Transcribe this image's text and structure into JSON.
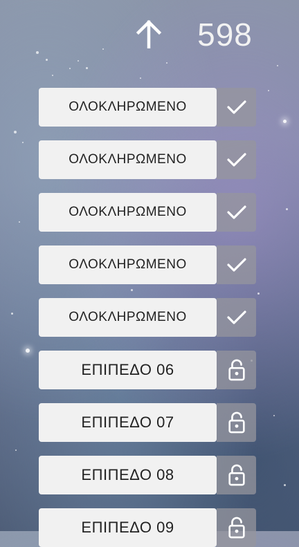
{
  "header": {
    "up_icon": "arrow-up-icon",
    "score": "598"
  },
  "levels": [
    {
      "label": "ΟΛΟΚΛΗΡΩΜΕΝΟ",
      "status": "completed",
      "icon": "check-icon"
    },
    {
      "label": "ΟΛΟΚΛΗΡΩΜΕΝΟ",
      "status": "completed",
      "icon": "check-icon"
    },
    {
      "label": "ΟΛΟΚΛΗΡΩΜΕΝΟ",
      "status": "completed",
      "icon": "check-icon"
    },
    {
      "label": "ΟΛΟΚΛΗΡΩΜΕΝΟ",
      "status": "completed",
      "icon": "check-icon"
    },
    {
      "label": "ΟΛΟΚΛΗΡΩΜΕΝΟ",
      "status": "completed",
      "icon": "check-icon"
    },
    {
      "label": "ΕΠΙΠΕΔΟ 06",
      "status": "locked",
      "icon": "lock-icon"
    },
    {
      "label": "ΕΠΙΠΕΔΟ 07",
      "status": "locked",
      "icon": "lock-icon"
    },
    {
      "label": "ΕΠΙΠΕΔΟ 08",
      "status": "locked",
      "icon": "lock-icon"
    },
    {
      "label": "ΕΠΙΠΕΔΟ 09",
      "status": "locked",
      "icon": "lock-icon"
    }
  ],
  "colors": {
    "button_bg": "#f1f1f1",
    "status_tile_bg": "#96969e",
    "icon": "#ffffff",
    "text": "#222222"
  }
}
